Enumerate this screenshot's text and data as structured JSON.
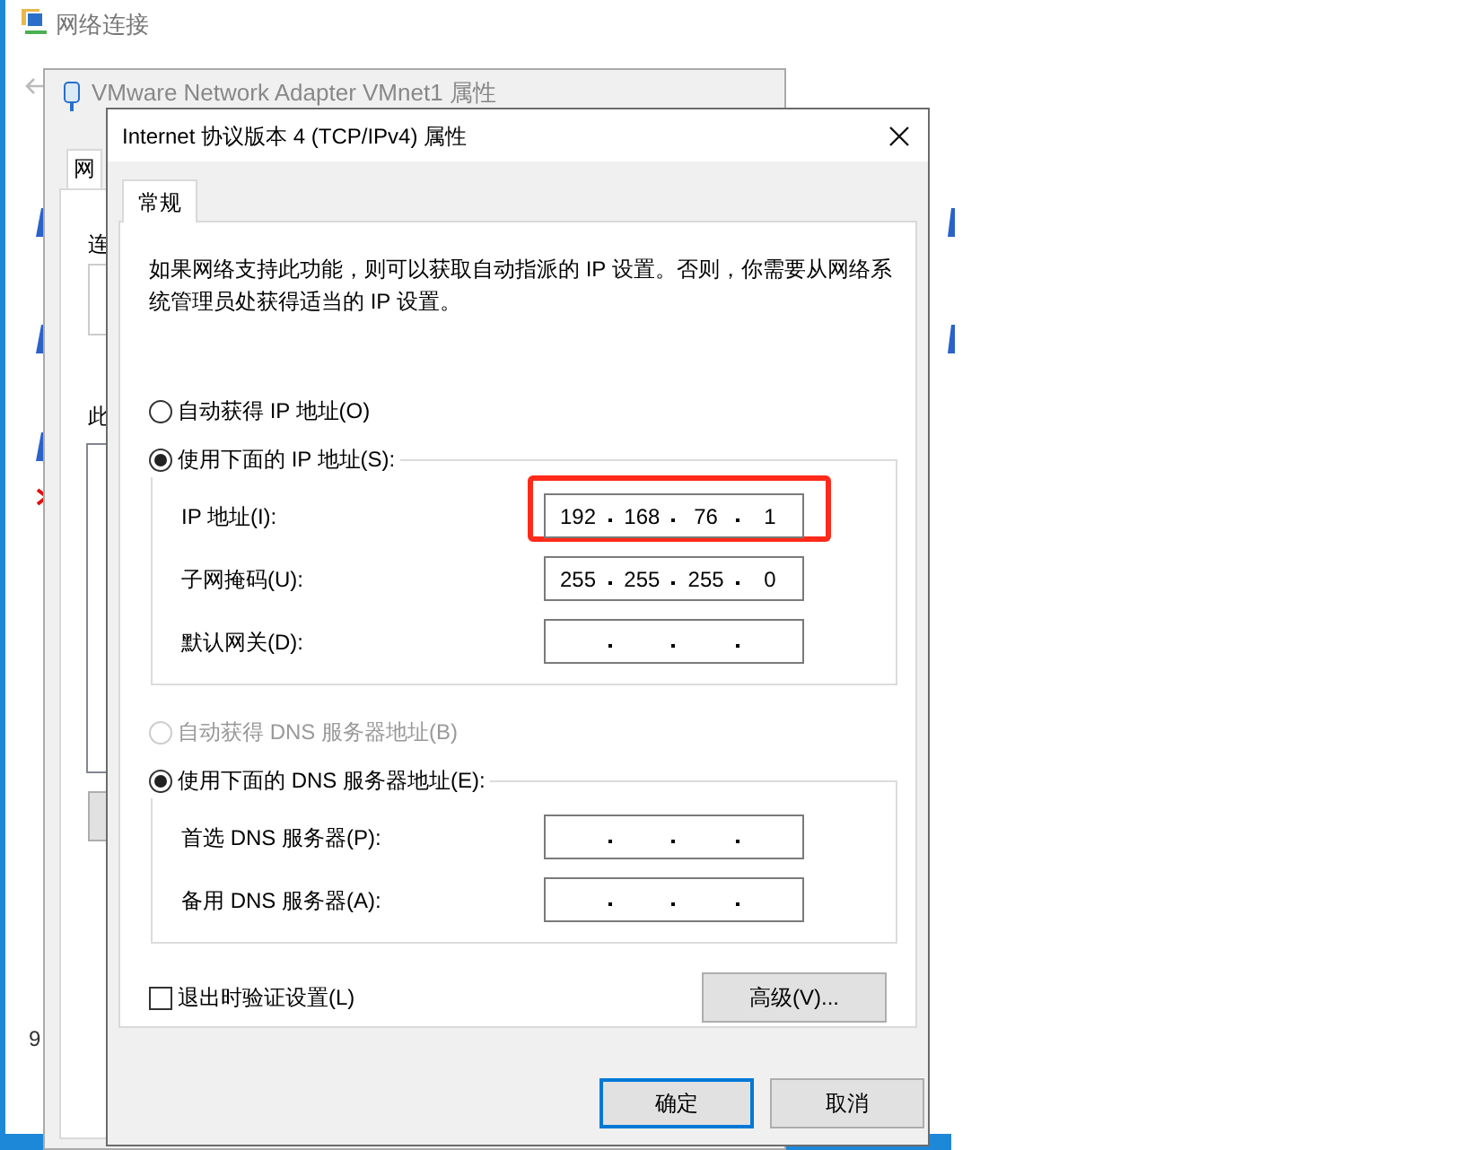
{
  "explorer": {
    "title": "网络连接",
    "footer_fragment": "9"
  },
  "adapter_window": {
    "title": "VMware Network Adapter VMnet1 属性",
    "tab": "网",
    "fragments": [
      "连",
      "此"
    ]
  },
  "dialog": {
    "title": "Internet 协议版本 4 (TCP/IPv4) 属性",
    "tabs": [
      {
        "label": "常规",
        "selected": true
      }
    ],
    "description": "如果网络支持此功能，则可以获取自动指派的 IP 设置。否则，你需要从网络系统管理员处获得适当的 IP 设置。",
    "groups": [
      {
        "radios": [
          {
            "label": "自动获得 IP 地址(O)",
            "selected": false,
            "disabled": false
          },
          {
            "label": "使用下面的 IP 地址(S):",
            "selected": true,
            "disabled": false
          }
        ],
        "fields": [
          {
            "label": "IP 地址(I):",
            "octets": [
              "192",
              "168",
              "76",
              "1"
            ],
            "highlighted": true
          },
          {
            "label": "子网掩码(U):",
            "octets": [
              "255",
              "255",
              "255",
              "0"
            ],
            "highlighted": false
          },
          {
            "label": "默认网关(D):",
            "highlighted": false
          }
        ]
      },
      {
        "radios": [
          {
            "label": "自动获得 DNS 服务器地址(B)",
            "selected": false,
            "disabled": true
          },
          {
            "label": "使用下面的 DNS 服务器地址(E):",
            "selected": true,
            "disabled": false
          }
        ],
        "fields": [
          {
            "label": "首选 DNS 服务器(P):",
            "highlighted": false
          },
          {
            "label": "备用 DNS 服务器(A):",
            "highlighted": false
          }
        ]
      }
    ],
    "validate": {
      "label": "退出时验证设置(L)",
      "checked": false
    },
    "advanced_button": "高级(V)...",
    "buttons": [
      {
        "label": "确定",
        "default": true
      },
      {
        "label": "取消",
        "default": false
      }
    ]
  }
}
